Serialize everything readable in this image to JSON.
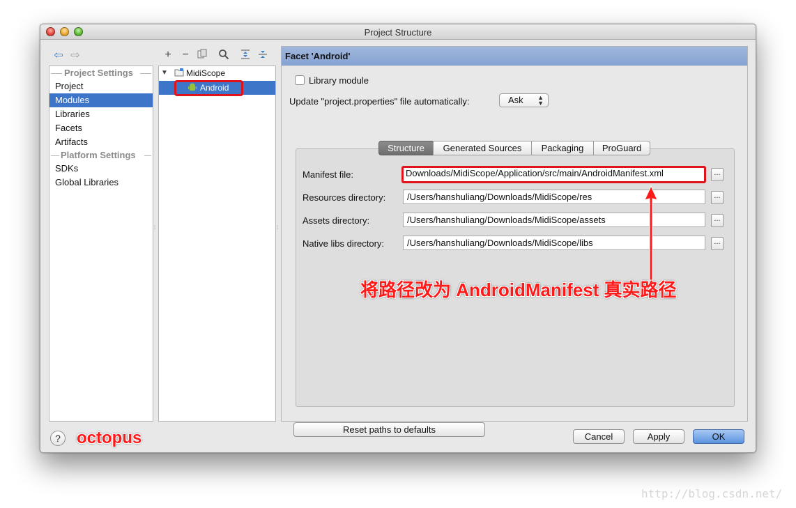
{
  "window": {
    "title": "Project Structure"
  },
  "sidebar": {
    "project_settings_header": "Project Settings",
    "platform_settings_header": "Platform Settings",
    "items": [
      {
        "label": "Project"
      },
      {
        "label": "Modules",
        "selected": true
      },
      {
        "label": "Libraries"
      },
      {
        "label": "Facets"
      },
      {
        "label": "Artifacts"
      }
    ],
    "platform_items": [
      {
        "label": "SDKs"
      },
      {
        "label": "Global Libraries"
      }
    ]
  },
  "toolbar": {
    "icons": [
      "add-icon",
      "remove-icon",
      "copy-icon",
      "find-icon",
      "expand-all-icon",
      "collapse-all-icon"
    ],
    "add": "+",
    "remove": "−"
  },
  "tree": {
    "module": "MidiScope",
    "facet": "Android"
  },
  "facet": {
    "header": "Facet 'Android'",
    "library_module_label": "Library module",
    "update_label": "Update \"project.properties\" file automatically:",
    "update_value": "Ask",
    "tabs": [
      "Structure",
      "Generated Sources",
      "Packaging",
      "ProGuard"
    ],
    "selected_tab": "Structure",
    "fields": {
      "manifest": {
        "label": "Manifest file:",
        "value": "Downloads/MidiScope/Application/src/main/AndroidManifest.xml"
      },
      "resources": {
        "label": "Resources directory:",
        "value": "/Users/hanshuliang/Downloads/MidiScope/res"
      },
      "assets": {
        "label": "Assets directory:",
        "value": "/Users/hanshuliang/Downloads/MidiScope/assets"
      },
      "native_libs": {
        "label": "Native libs directory:",
        "value": "/Users/hanshuliang/Downloads/MidiScope/libs"
      }
    },
    "browse_label": "...",
    "reset_button": "Reset paths to defaults"
  },
  "footer": {
    "help": "?",
    "cancel": "Cancel",
    "apply": "Apply",
    "ok": "OK"
  },
  "overlay": {
    "annotation": "将路径改为 AndroidManifest 真实路径",
    "signature": "octopus",
    "watermark": "http://blog.csdn.net/",
    "highlight_color": "#e0121b"
  }
}
